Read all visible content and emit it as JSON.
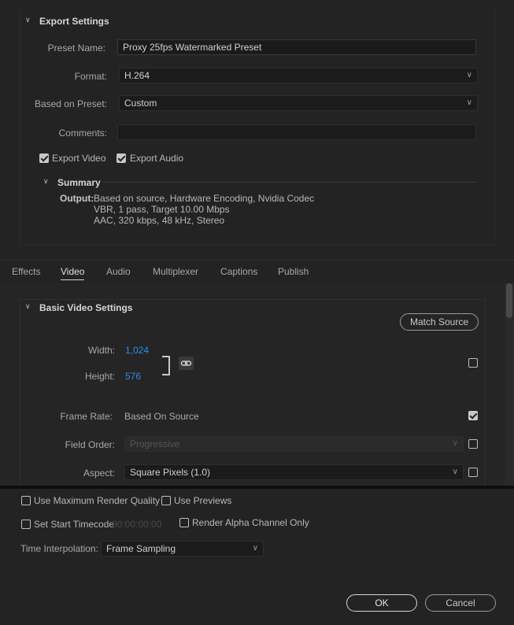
{
  "export_settings": {
    "title": "Export Settings",
    "preset_name_label": "Preset Name:",
    "preset_name_value": "Proxy 25fps Watermarked Preset",
    "format_label": "Format:",
    "format_value": "H.264",
    "based_on_preset_label": "Based on Preset:",
    "based_on_preset_value": "Custom",
    "comments_label": "Comments:",
    "comments_value": "",
    "export_video_label": "Export Video",
    "export_video_checked": true,
    "export_audio_label": "Export Audio",
    "export_audio_checked": true,
    "summary": {
      "title": "Summary",
      "output_label": "Output:",
      "output_lines": [
        "Based on source, Hardware Encoding, Nvidia Codec",
        "VBR, 1 pass, Target 10.00 Mbps",
        "AAC, 320 kbps, 48 kHz, Stereo"
      ]
    }
  },
  "tabs": [
    {
      "label": "Effects",
      "active": false
    },
    {
      "label": "Video",
      "active": true
    },
    {
      "label": "Audio",
      "active": false
    },
    {
      "label": "Multiplexer",
      "active": false
    },
    {
      "label": "Captions",
      "active": false
    },
    {
      "label": "Publish",
      "active": false
    }
  ],
  "basic_video": {
    "title": "Basic Video Settings",
    "match_source_label": "Match Source",
    "width_label": "Width:",
    "width_value": "1,024",
    "height_label": "Height:",
    "height_value": "576",
    "frame_rate_label": "Frame Rate:",
    "frame_rate_value": "Based On Source",
    "frame_rate_checked": true,
    "field_order_label": "Field Order:",
    "field_order_value": "Progressive",
    "field_order_checked": false,
    "aspect_label": "Aspect:",
    "aspect_value": "Square Pixels (1.0)",
    "aspect_checked": false,
    "size_checked": false
  },
  "bottom": {
    "max_render_quality_label": "Use Maximum Render Quality",
    "use_previews_label": "Use Previews",
    "set_start_timecode_label": "Set Start Timecode",
    "timecode_value": "00:00:00:00",
    "render_alpha_label": "Render Alpha Channel Only",
    "time_interpolation_label": "Time Interpolation:",
    "time_interpolation_value": "Frame Sampling",
    "ok_label": "OK",
    "cancel_label": "Cancel"
  },
  "icons": {
    "chevron": "chevron-down-icon",
    "dropdown": "dropdown-arrow-icon",
    "link": "link-icon"
  },
  "colors": {
    "background": "#232323",
    "accent_blue": "#2d8ceb"
  }
}
